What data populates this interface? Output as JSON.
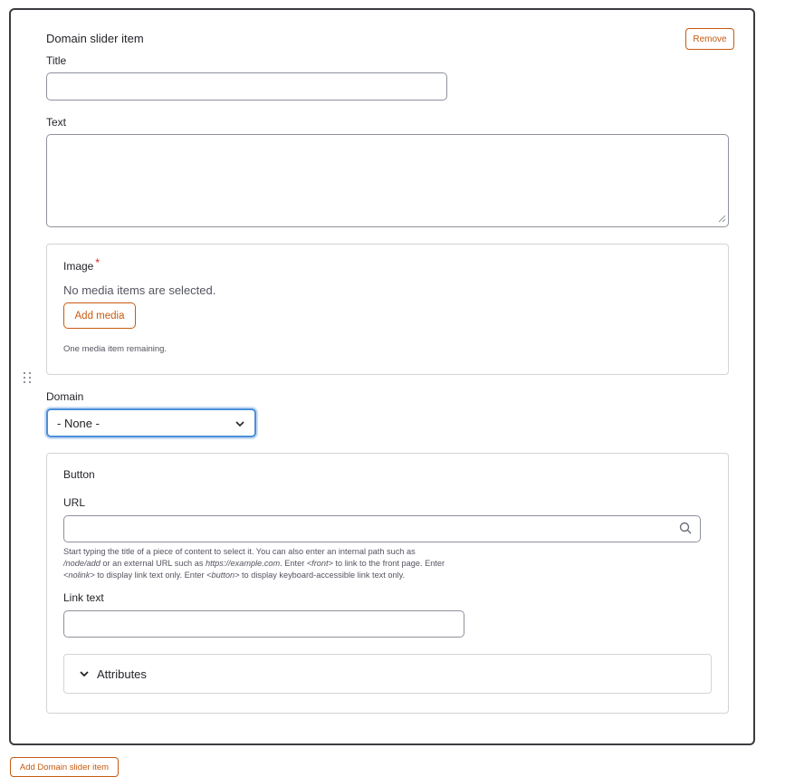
{
  "item": {
    "title": "Domain slider item",
    "remove_label": "Remove"
  },
  "fields": {
    "title": {
      "label": "Title",
      "value": ""
    },
    "text": {
      "label": "Text",
      "value": ""
    },
    "image": {
      "label": "Image",
      "required_mark": "*",
      "empty_message": "No media items are selected.",
      "add_label": "Add media",
      "remaining": "One media item remaining."
    },
    "domain": {
      "label": "Domain",
      "selected": "- None -"
    },
    "button": {
      "legend": "Button",
      "url_label": "URL",
      "url_value": "",
      "help_1": "Start typing the title of a piece of content to select it. You can also enter an internal path such as",
      "help_path": "/node/add",
      "help_2": " or an external URL such as ",
      "help_url": "https://example.com",
      "help_3": ". Enter ",
      "help_front": "<front>",
      "help_4": " to link to the front page. Enter",
      "help_nolink": "<nolink>",
      "help_5": " to display link text only. Enter ",
      "help_button": "<button>",
      "help_6": " to display keyboard-accessible link text only.",
      "link_text_label": "Link text",
      "link_text_value": "",
      "attributes_label": "Attributes"
    }
  },
  "footer": {
    "add_label": "Add Domain slider item"
  },
  "colors": {
    "accent": "#c65b10",
    "focus": "#4b8fd8",
    "required": "#d72222"
  },
  "icons": [
    "drag-handle-icon",
    "chevron-down-icon",
    "search-icon",
    "resize-grip-icon"
  ]
}
